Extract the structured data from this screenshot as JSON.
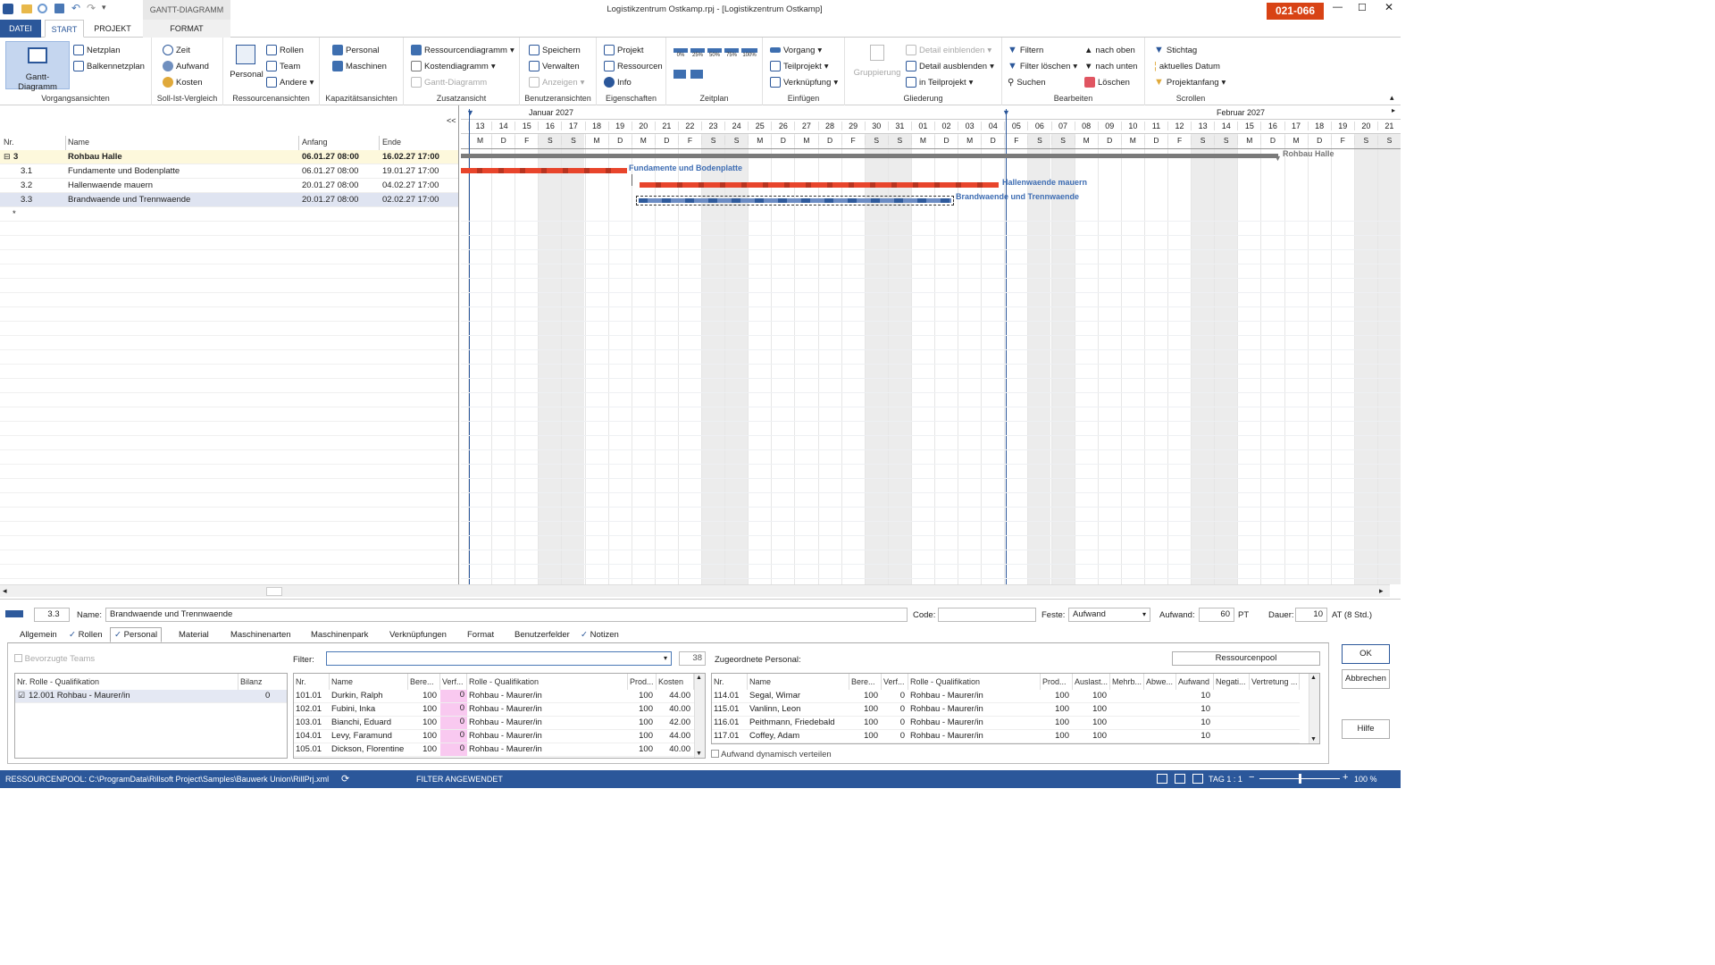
{
  "window": {
    "title": "Logistikzentrum Ostkamp.rpj - [Logistikzentrum Ostkamp]",
    "context_tab": "GANTT-DIAGRAMM",
    "badge": "021-066"
  },
  "tabs": [
    "DATEI",
    "START",
    "PROJEKT",
    "FORMAT"
  ],
  "ribbon": {
    "vorgangsansichten": {
      "label": "Vorgangsansichten",
      "gantt": "Gantt-Diagramm",
      "netzplan": "Netzplan",
      "balkennetzplan": "Balkennetzplan"
    },
    "sollist": {
      "label": "Soll-Ist-Vergleich",
      "zeit": "Zeit",
      "aufwand": "Aufwand",
      "kosten": "Kosten"
    },
    "ressourcen": {
      "label": "Ressourcenansichten",
      "personal": "Personal",
      "rollen": "Rollen",
      "team": "Team",
      "andere": "Andere"
    },
    "kapazitaet": {
      "label": "Kapazitätsansichten",
      "personal": "Personal",
      "maschinen": "Maschinen"
    },
    "zusatz": {
      "label": "Zusatzansicht",
      "ressourcendiagramm": "Ressourcendiagramm",
      "kostendiagramm": "Kostendiagramm",
      "gantt": "Gantt-Diagramm"
    },
    "benutzer": {
      "label": "Benutzeransichten",
      "speichern": "Speichern",
      "verwalten": "Verwalten",
      "anzeigen": "Anzeigen"
    },
    "eigenschaften": {
      "label": "Eigenschaften",
      "projekt": "Projekt",
      "ressourcen": "Ressourcen",
      "info": "Info"
    },
    "zeitplan": {
      "label": "Zeitplan",
      "pcts": [
        "0%",
        "25%",
        "50%",
        "75%",
        "100%"
      ]
    },
    "einfuegen": {
      "label": "Einfügen",
      "vorgang": "Vorgang",
      "teilprojekt": "Teilprojekt",
      "verknuepfung": "Verknüpfung"
    },
    "gliederung": {
      "label": "Gliederung",
      "gruppierung": "Gruppierung",
      "einblenden": "Detail einblenden",
      "ausblenden": "Detail ausblenden",
      "teilprojekt": "in Teilprojekt"
    },
    "bearbeiten": {
      "label": "Bearbeiten",
      "filtern": "Filtern",
      "filter_loeschen": "Filter löschen",
      "suchen": "Suchen",
      "nach_oben": "nach oben",
      "nach_unten": "nach unten",
      "loeschen": "Löschen"
    },
    "scrollen": {
      "label": "Scrollen",
      "stichtag": "Stichtag",
      "aktuelles_datum": "aktuelles Datum",
      "projektanfang": "Projektanfang"
    }
  },
  "table": {
    "collapse": "<<",
    "headers": {
      "nr": "Nr.",
      "name": "Name",
      "anfang": "Anfang",
      "ende": "Ende"
    },
    "rows": [
      {
        "nr": "3",
        "name": "Rohbau Halle",
        "anfang": "06.01.27 08:00",
        "ende": "16.02.27 17:00"
      },
      {
        "nr": "3.1",
        "name": "Fundamente und Bodenplatte",
        "anfang": "06.01.27 08:00",
        "ende": "19.01.27 17:00"
      },
      {
        "nr": "3.2",
        "name": "Hallenwaende mauern",
        "anfang": "20.01.27 08:00",
        "ende": "04.02.27 17:00"
      },
      {
        "nr": "3.3",
        "name": "Brandwaende und Trennwaende",
        "anfang": "20.01.27 08:00",
        "ende": "02.02.27 17:00"
      }
    ],
    "new_row": "*"
  },
  "gantt": {
    "months": [
      "Januar 2027",
      "Februar 2027"
    ],
    "days": [
      "13",
      "14",
      "15",
      "16",
      "17",
      "18",
      "19",
      "20",
      "21",
      "22",
      "23",
      "24",
      "25",
      "26",
      "27",
      "28",
      "29",
      "30",
      "31",
      "01",
      "02",
      "03",
      "04",
      "05",
      "06",
      "07",
      "08",
      "09",
      "10",
      "11",
      "12",
      "13",
      "14",
      "15",
      "16",
      "17",
      "18",
      "19",
      "20",
      "21"
    ],
    "weekdays": [
      "M",
      "D",
      "F",
      "S",
      "S",
      "M",
      "D",
      "M",
      "D",
      "F",
      "S",
      "S",
      "M",
      "D",
      "M",
      "D",
      "F",
      "S",
      "S",
      "M",
      "D",
      "M",
      "D",
      "F",
      "S",
      "S",
      "M",
      "D",
      "M",
      "D",
      "F",
      "S",
      "S",
      "M",
      "D",
      "M",
      "D",
      "F",
      "S",
      "S"
    ],
    "bar_labels": [
      "Rohbau Halle",
      "Fundamente und Bodenplatte",
      "Hallenwaende mauern",
      "Brandwaende und Trennwaende"
    ]
  },
  "detail": {
    "nr": "3.3",
    "name_label": "Name:",
    "name": "Brandwaende und Trennwaende",
    "code_label": "Code:",
    "code": "",
    "feste_label": "Feste:",
    "feste": "Aufwand",
    "aufwand_label": "Aufwand:",
    "aufwand": "60",
    "aufwand_unit": "PT",
    "dauer_label": "Dauer:",
    "dauer": "10",
    "dauer_unit": "AT (8 Std.)",
    "tabs": [
      "Allgemein",
      "Rollen",
      "Personal",
      "Material",
      "Maschinenarten",
      "Maschinenpark",
      "Verknüpfungen",
      "Format",
      "Benutzerfelder",
      "Notizen"
    ],
    "bevorzugte_teams": "Bevorzugte Teams",
    "filter_label": "Filter:",
    "filter_count": "38",
    "zugeordnet_label": "Zugeordnete Personal:",
    "ressourcenpool": "Ressourcenpool",
    "roles_grid": {
      "headers": [
        "Nr. Rolle - Qualifikation",
        "Bilanz"
      ],
      "rows": [
        {
          "role": "12.001 Rohbau - Maurer/in",
          "bilanz": "0"
        }
      ]
    },
    "avail_grid": {
      "headers": [
        "Nr.",
        "Name",
        "Bere...",
        "Verf...",
        "Rolle - Qualifikation",
        "Prod...",
        "Kosten"
      ],
      "rows": [
        [
          "101.01",
          "Durkin, Ralph",
          "100",
          "0",
          "Rohbau - Maurer/in",
          "100",
          "44.00"
        ],
        [
          "102.01",
          "Fubini, Inka",
          "100",
          "0",
          "Rohbau - Maurer/in",
          "100",
          "40.00"
        ],
        [
          "103.01",
          "Bianchi, Eduard",
          "100",
          "0",
          "Rohbau - Maurer/in",
          "100",
          "42.00"
        ],
        [
          "104.01",
          "Levy, Faramund",
          "100",
          "0",
          "Rohbau - Maurer/in",
          "100",
          "44.00"
        ],
        [
          "105.01",
          "Dickson, Florentine",
          "100",
          "0",
          "Rohbau - Maurer/in",
          "100",
          "40.00"
        ]
      ]
    },
    "assigned_grid": {
      "headers": [
        "Nr.",
        "Name",
        "Bere...",
        "Verf...",
        "Rolle - Qualifikation",
        "Prod...",
        "Auslast...",
        "Mehrb...",
        "Abwe...",
        "Aufwand",
        "Negati...",
        "Vertretung ..."
      ],
      "rows": [
        [
          "114.01",
          "Segal, Wimar",
          "100",
          "0",
          "Rohbau - Maurer/in",
          "100",
          "100",
          "",
          "",
          "10",
          "",
          ""
        ],
        [
          "115.01",
          "Vanlinn, Leon",
          "100",
          "0",
          "Rohbau - Maurer/in",
          "100",
          "100",
          "",
          "",
          "10",
          "",
          ""
        ],
        [
          "116.01",
          "Peithmann, Friedebald",
          "100",
          "0",
          "Rohbau - Maurer/in",
          "100",
          "100",
          "",
          "",
          "10",
          "",
          ""
        ],
        [
          "117.01",
          "Coffey, Adam",
          "100",
          "0",
          "Rohbau - Maurer/in",
          "100",
          "100",
          "",
          "",
          "10",
          "",
          ""
        ]
      ]
    },
    "dynamisch": "Aufwand dynamisch verteilen",
    "ok": "OK",
    "abbrechen": "Abbrechen",
    "hilfe": "Hilfe"
  },
  "status": {
    "pool": "RESSOURCENPOOL: C:\\ProgramData\\Rillsoft Project\\Samples\\Bauwerk Union\\RillPrj.xml",
    "filter": "FILTER ANGEWENDET",
    "tag": "TAG 1 : 1",
    "zoom": "100 %"
  },
  "colors": {
    "accent": "#2b579a",
    "bar_red": "#e8452c",
    "bar_blue": "#2e5a9c",
    "badge": "#d84315",
    "summary": "#7a7a7a"
  }
}
